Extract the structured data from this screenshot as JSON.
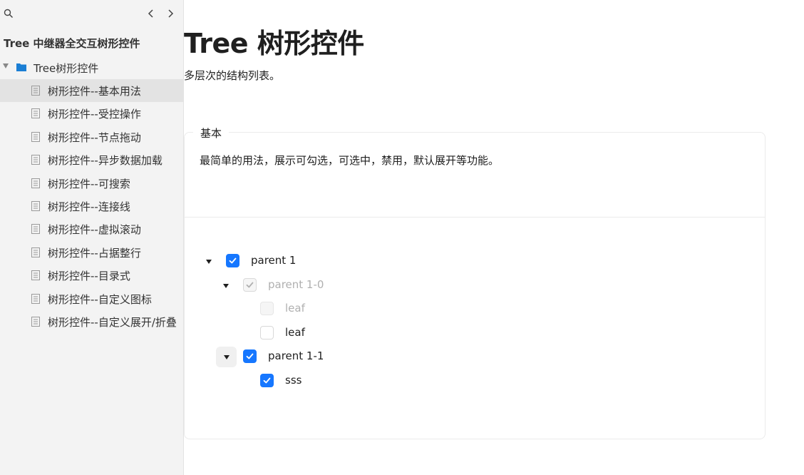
{
  "sidebar": {
    "title": "Tree 中继器全交互树形控件",
    "folder": {
      "label": "Tree树形控件",
      "expanded": true
    },
    "items": [
      {
        "label": "树形控件--基本用法",
        "active": true
      },
      {
        "label": "树形控件--受控操作",
        "active": false
      },
      {
        "label": "树形控件--节点拖动",
        "active": false
      },
      {
        "label": "树形控件--异步数据加载",
        "active": false
      },
      {
        "label": "树形控件--可搜索",
        "active": false
      },
      {
        "label": "树形控件--连接线",
        "active": false
      },
      {
        "label": "树形控件--虚拟滚动",
        "active": false
      },
      {
        "label": "树形控件--占据整行",
        "active": false
      },
      {
        "label": "树形控件--目录式",
        "active": false
      },
      {
        "label": "树形控件--自定义图标",
        "active": false
      },
      {
        "label": "树形控件--自定义展开/折叠",
        "active": false
      }
    ]
  },
  "main": {
    "title": "Tree 树形控件",
    "description": "多层次的结构列表。",
    "demo": {
      "legend": "基本",
      "description": "最简单的用法，展示可勾选，可选中，禁用，默认展开等功能。",
      "tree": [
        {
          "title": "parent 1",
          "level": 0,
          "expandable": true,
          "expanded": true,
          "checkbox": "checked",
          "disabled": false
        },
        {
          "title": "parent 1-0",
          "level": 1,
          "expandable": true,
          "expanded": true,
          "checkbox": "checked",
          "disabled": true
        },
        {
          "title": "leaf",
          "level": 2,
          "expandable": false,
          "checkbox": "unchecked",
          "disabled": true
        },
        {
          "title": "leaf",
          "level": 2,
          "expandable": false,
          "checkbox": "unchecked",
          "disabled": false
        },
        {
          "title": "parent 1-1",
          "level": 1,
          "expandable": true,
          "expanded": true,
          "checkbox": "checked",
          "disabled": false,
          "hovered": true
        },
        {
          "title": "sss",
          "level": 2,
          "expandable": false,
          "checkbox": "checked",
          "disabled": false
        }
      ]
    }
  },
  "colors": {
    "accent": "#1677ff",
    "folder_icon": "#1a7ed4",
    "sidebar_bg": "#f3f3f3",
    "active_item_bg": "#e3e3e3",
    "disabled_text": "#b0b0b0"
  }
}
